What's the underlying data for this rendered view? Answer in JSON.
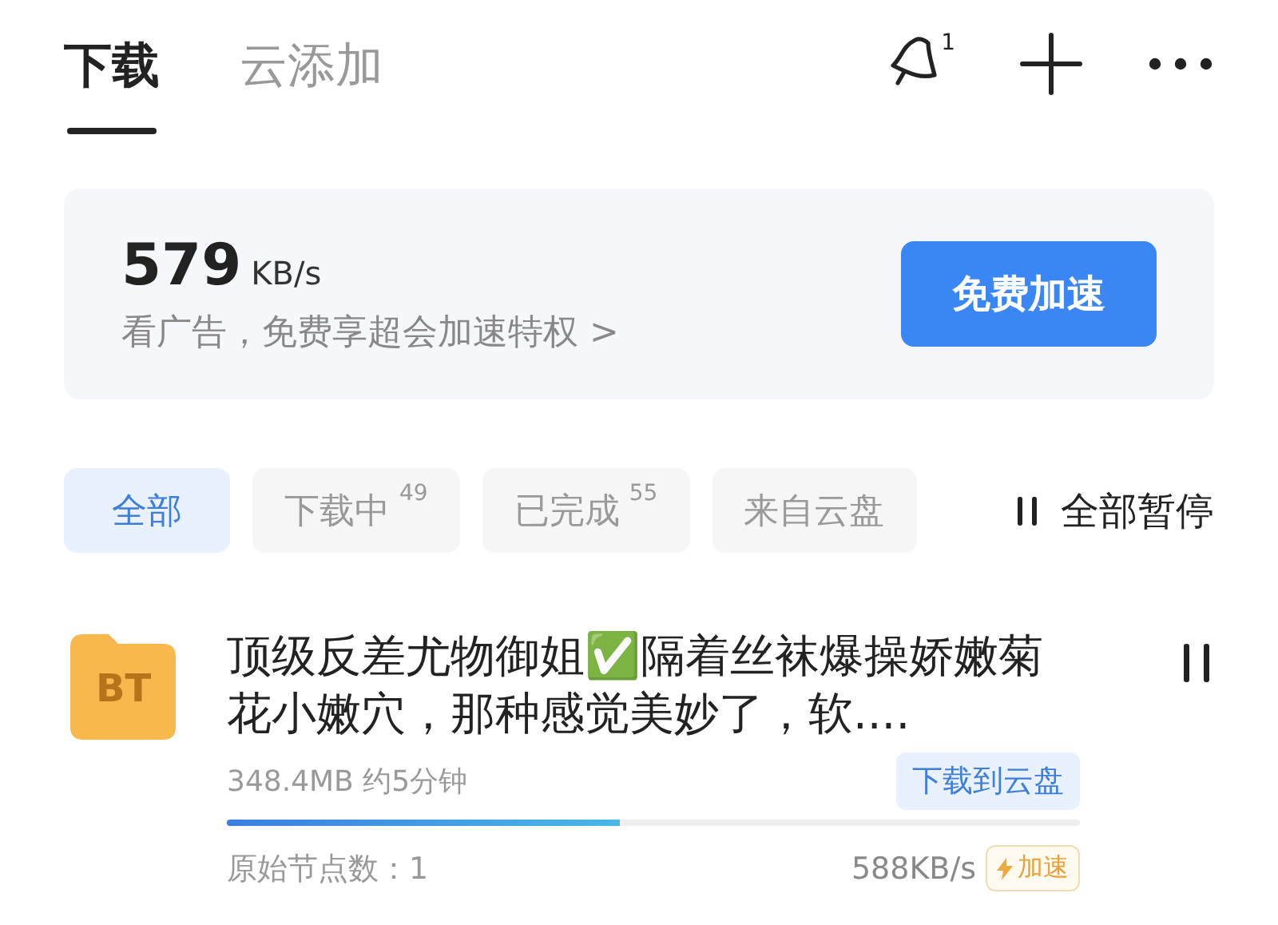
{
  "tabs": [
    {
      "label": "下载",
      "selected": true
    },
    {
      "label": "云添加",
      "selected": false
    }
  ],
  "toolbar": {
    "notification_count": "1"
  },
  "speed_banner": {
    "speed": "579",
    "unit": "KB/s",
    "promo": "看广告，免费享超会加速特权 >",
    "button": "免费加速"
  },
  "filters": [
    {
      "label": "全部",
      "selected": true
    },
    {
      "label": "下载中",
      "count": "49",
      "selected": false
    },
    {
      "label": "已完成",
      "count": "55",
      "selected": false
    },
    {
      "label": "来自云盘",
      "selected": false
    }
  ],
  "pause_all": "全部暂停",
  "tasks": [
    {
      "badge": "BT",
      "title": "顶级反差尤物御姐✅隔着丝袜爆操娇嫩菊花小嫩穴，那种感觉美妙了，软....",
      "size": "348.4MB",
      "eta": "约5分钟",
      "cloud_button": "下载到云盘",
      "level": 0.46,
      "nodes": "原始节点数：1",
      "speed": "588KB/s",
      "boost": "加速"
    }
  ]
}
